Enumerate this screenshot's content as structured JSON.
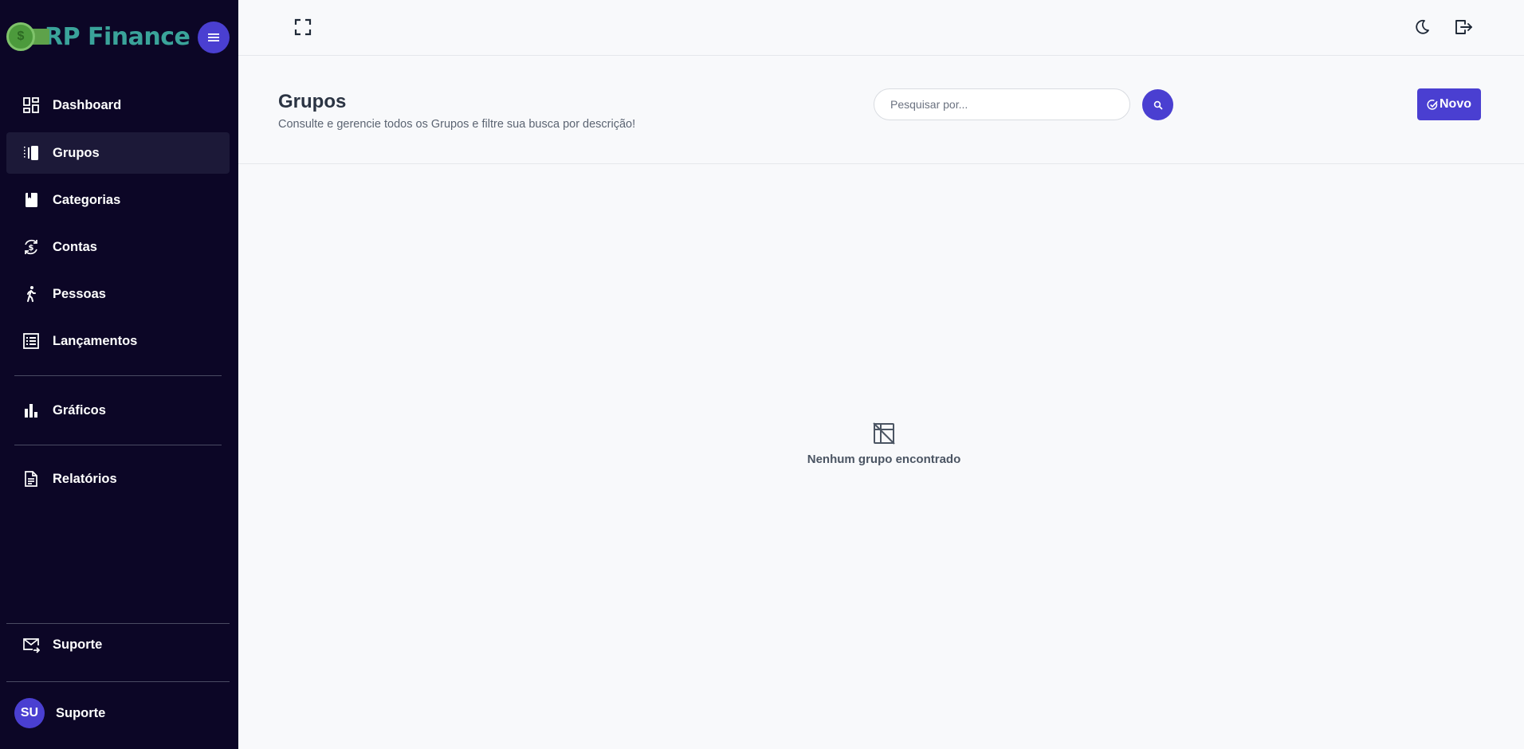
{
  "app": {
    "logo_text": "RP Finance",
    "coin_symbol": "$",
    "brand_color": "#4a3fd1",
    "sidebar_bg": "#0c0626"
  },
  "sidebar": {
    "items": [
      {
        "label": "Dashboard",
        "icon": "dashboard-icon",
        "active": false
      },
      {
        "label": "Grupos",
        "icon": "groups-icon",
        "active": true
      },
      {
        "label": "Categorias",
        "icon": "book-icon",
        "active": false
      },
      {
        "label": "Contas",
        "icon": "currency-exchange-icon",
        "active": false
      },
      {
        "label": "Pessoas",
        "icon": "walking-person-icon",
        "active": false
      },
      {
        "label": "Lançamentos",
        "icon": "list-icon",
        "active": false
      },
      {
        "label": "Gráficos",
        "icon": "bar-chart-icon",
        "active": false
      },
      {
        "label": "Relatórios",
        "icon": "document-icon",
        "active": false
      }
    ],
    "support": {
      "label": "Suporte",
      "icon": "mail-forward-icon"
    },
    "user": {
      "initials": "SU",
      "name": "Suporte"
    }
  },
  "topbar": {
    "fullscreen_icon": "fullscreen-icon",
    "theme_icon": "moon-icon",
    "logout_icon": "logout-icon"
  },
  "header": {
    "title": "Grupos",
    "subtitle": "Consulte e gerencie todos os Grupos e filtre sua busca por descrição!",
    "search_placeholder": "Pesquisar por...",
    "search_value": "",
    "new_button": "Novo"
  },
  "empty_state": {
    "message": "Nenhum grupo encontrado",
    "icon": "grid-off-icon"
  }
}
